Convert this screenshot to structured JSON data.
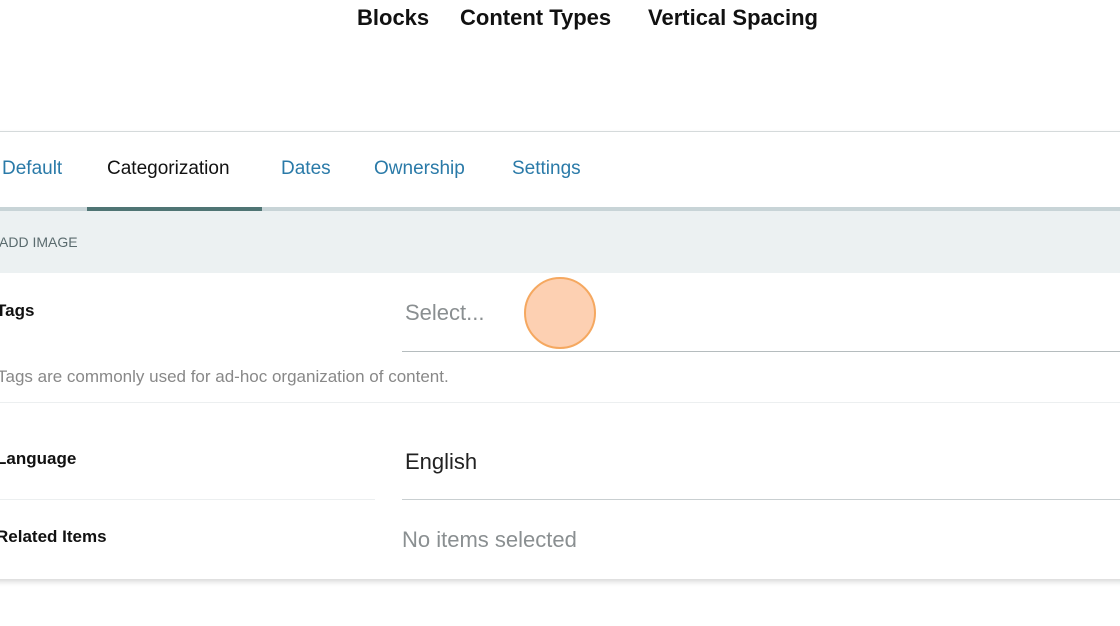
{
  "topnav": {
    "items": [
      "Blocks",
      "Content Types",
      "Vertical Spacing"
    ]
  },
  "tabs": [
    {
      "label": "Default"
    },
    {
      "label": "Categorization",
      "active": true
    },
    {
      "label": "Dates"
    },
    {
      "label": "Ownership"
    },
    {
      "label": "Settings"
    }
  ],
  "add_image": "ADD IMAGE",
  "fields": {
    "tags": {
      "label": "Tags",
      "placeholder": "Select...",
      "help": "Tags are commonly used for ad-hoc organization of content."
    },
    "language": {
      "label": "Language",
      "value": "English"
    },
    "related": {
      "label": "Related Items",
      "value": "No items selected"
    }
  },
  "colors": {
    "accent": "#2a7aa8",
    "active_tab_underline": "#4f7574",
    "band": "#ecf1f2",
    "cursor": "#fdd0b0"
  }
}
